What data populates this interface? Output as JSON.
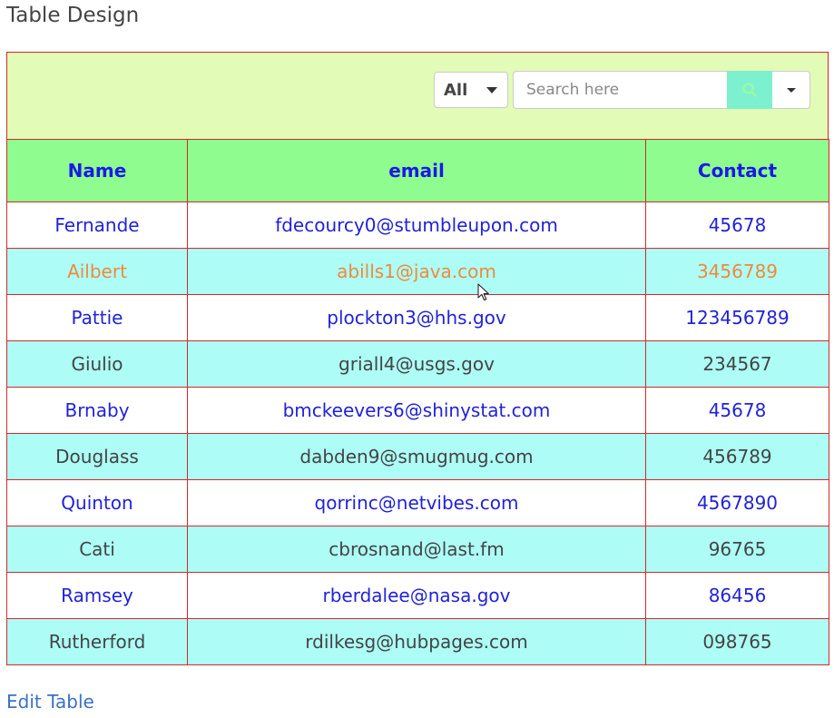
{
  "page": {
    "title": "Table Design"
  },
  "toolbar": {
    "filter_value": "All",
    "search_placeholder": "Search here",
    "search_icon": "search-icon",
    "dropdown_icon": "chevron-down-icon"
  },
  "table": {
    "columns": [
      "Name",
      "email",
      "Contact"
    ],
    "rows": [
      {
        "name": "Fernande",
        "email": "fdecourcy0@stumbleupon.com",
        "contact": "45678"
      },
      {
        "name": "Ailbert",
        "email": "abills1@java.com",
        "contact": "3456789"
      },
      {
        "name": "Pattie",
        "email": "plockton3@hhs.gov",
        "contact": "123456789"
      },
      {
        "name": "Giulio",
        "email": "griall4@usgs.gov",
        "contact": "234567"
      },
      {
        "name": "Brnaby",
        "email": "bmckeevers6@shinystat.com",
        "contact": "45678"
      },
      {
        "name": "Douglass",
        "email": "dabden9@smugmug.com",
        "contact": "456789"
      },
      {
        "name": "Quinton",
        "email": "qorrinc@netvibes.com",
        "contact": "4567890"
      },
      {
        "name": "Cati",
        "email": "cbrosnand@last.fm",
        "contact": "96765"
      },
      {
        "name": "Ramsey",
        "email": "rberdalee@nasa.gov",
        "contact": "86456"
      },
      {
        "name": "Rutherford",
        "email": "rdilkesg@hubpages.com",
        "contact": "098765"
      }
    ]
  },
  "footer": {
    "edit_link": "Edit Table"
  },
  "colors": {
    "toolbar_bg": "#e2fbb6",
    "header_bg": "#8efc8e",
    "header_text": "#1a1ae6",
    "row_alt_bg": "#adfcf6",
    "border": "#d32a2a",
    "search_button": "#7df0cf",
    "hover_text": "#ef8a3c",
    "link": "#3a72c4"
  }
}
